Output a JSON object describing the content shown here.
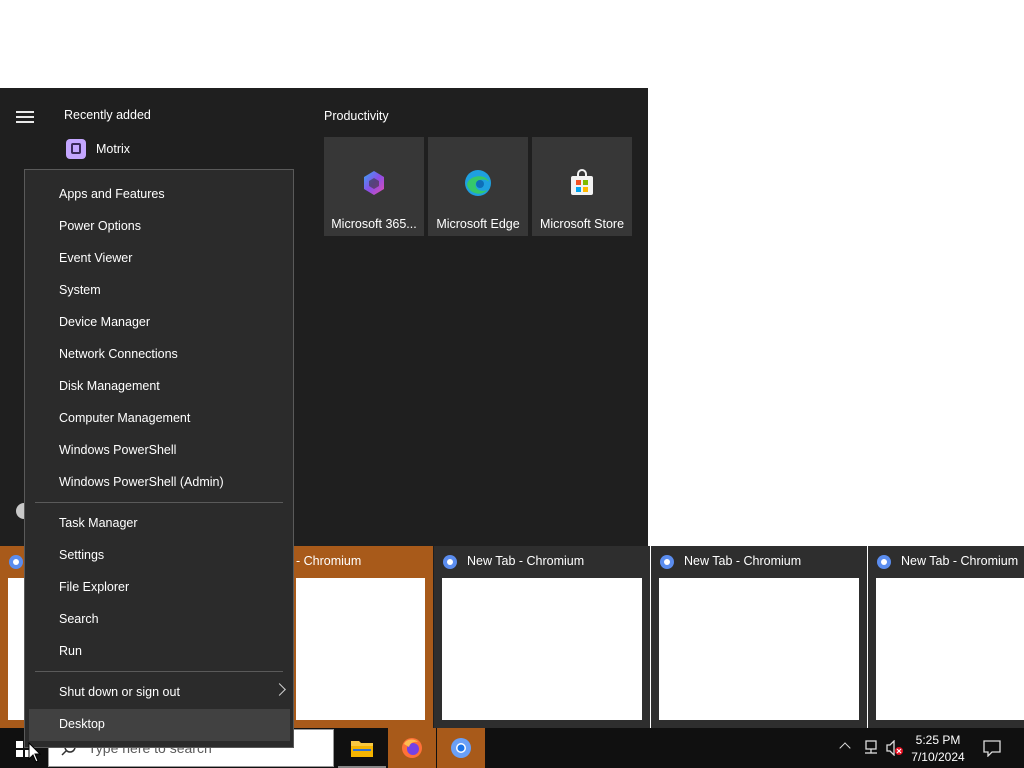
{
  "start_menu": {
    "recently_added_label": "Recently added",
    "recent_app": "Motrix",
    "group_label": "Productivity",
    "tiles": [
      {
        "label": "Microsoft 365...",
        "icon": "microsoft-365-icon"
      },
      {
        "label": "Microsoft Edge",
        "icon": "edge-icon"
      },
      {
        "label": "Microsoft Store",
        "icon": "store-icon"
      }
    ]
  },
  "task_view": {
    "windows": [
      {
        "title": "New Tab - Chromium"
      },
      {
        "title": "- Chromium"
      },
      {
        "title": "New Tab - Chromium"
      },
      {
        "title": "New Tab - Chromium"
      },
      {
        "title": "New Tab - Chromium"
      }
    ]
  },
  "context_menu": {
    "group1": [
      "Apps and Features",
      "Power Options",
      "Event Viewer",
      "System",
      "Device Manager",
      "Network Connections",
      "Disk Management",
      "Computer Management",
      "Windows PowerShell",
      "Windows PowerShell (Admin)"
    ],
    "group2": [
      "Task Manager",
      "Settings",
      "File Explorer",
      "Search",
      "Run"
    ],
    "shutdown": "Shut down or sign out",
    "desktop": "Desktop"
  },
  "taskbar": {
    "search_placeholder": "Type here to search",
    "apps": [
      "file-explorer-icon",
      "firefox-icon",
      "chromium-icon"
    ],
    "clock_time": "5:25 PM",
    "clock_date": "7/10/2024"
  },
  "colors": {
    "start_bg": "#1f1f1f",
    "menu_bg": "#2b2b2b",
    "taskbar_bg": "#101010",
    "active_window": "#a85a1a"
  }
}
